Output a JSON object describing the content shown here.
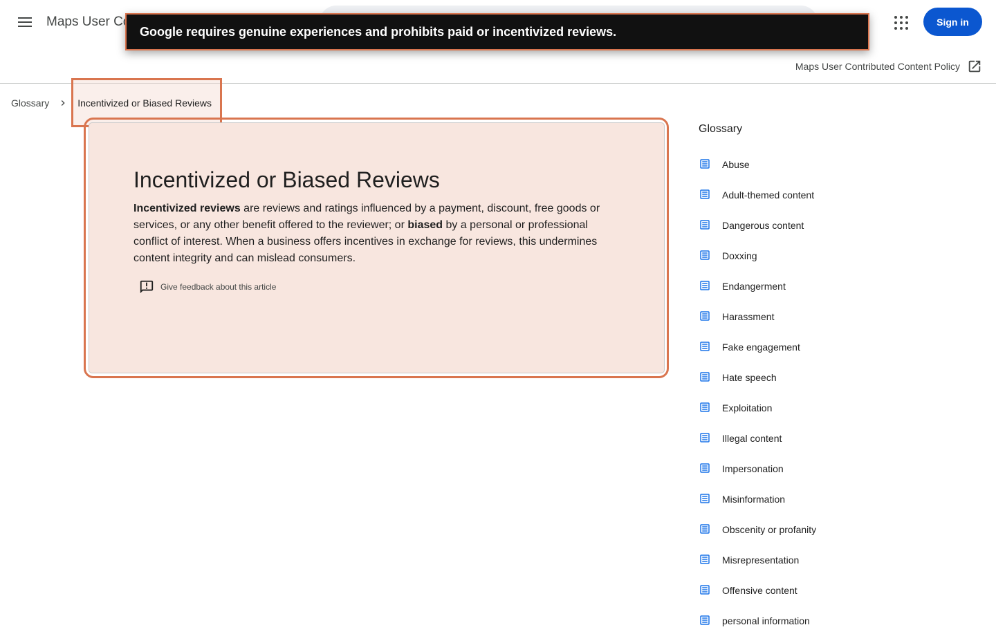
{
  "header": {
    "app_title": "Maps User Co",
    "signin_label": "Sign in",
    "menu_icon": "hamburger-menu-icon",
    "apps_icon": "apps-grid-icon"
  },
  "toast": {
    "message": "Google requires genuine experiences and prohibits paid or incentivized reviews."
  },
  "policy_link": {
    "label": "Maps User Contributed Content Policy",
    "icon": "open-in-new-icon"
  },
  "breadcrumb": {
    "parent": "Glossary",
    "current": "Incentivized or Biased Reviews",
    "separator_icon": "chevron-right-icon"
  },
  "article": {
    "title": "Incentivized or Biased Reviews",
    "body_term1": "Incentivized reviews",
    "body_part1": " are reviews and ratings influenced by a payment, discount, free goods or services, or any other benefit offered to the reviewer; or ",
    "body_term2": "biased",
    "body_part2": " by a personal or professional conflict of interest. When a business offers incentives in exchange for reviews, this undermines content integrity and can mislead consumers.",
    "feedback_label": "Give feedback about this article",
    "feedback_icon": "feedback-icon"
  },
  "sidebar": {
    "heading": "Glossary",
    "item_icon": "article-icon",
    "items": [
      {
        "label": "Abuse"
      },
      {
        "label": "Adult-themed content"
      },
      {
        "label": "Dangerous content"
      },
      {
        "label": "Doxxing"
      },
      {
        "label": "Endangerment"
      },
      {
        "label": "Harassment"
      },
      {
        "label": "Fake engagement"
      },
      {
        "label": "Hate speech"
      },
      {
        "label": "Exploitation"
      },
      {
        "label": "Illegal content"
      },
      {
        "label": "Impersonation"
      },
      {
        "label": "Misinformation"
      },
      {
        "label": "Obscenity or profanity"
      },
      {
        "label": "Misrepresentation"
      },
      {
        "label": "Offensive content"
      },
      {
        "label": "personal information"
      }
    ]
  },
  "colors": {
    "accent": "#0b57d0",
    "highlight_border": "#d9754f",
    "card_background": "#f8e6df",
    "toast_background": "#111111",
    "icon_blue": "#1a73e8"
  }
}
